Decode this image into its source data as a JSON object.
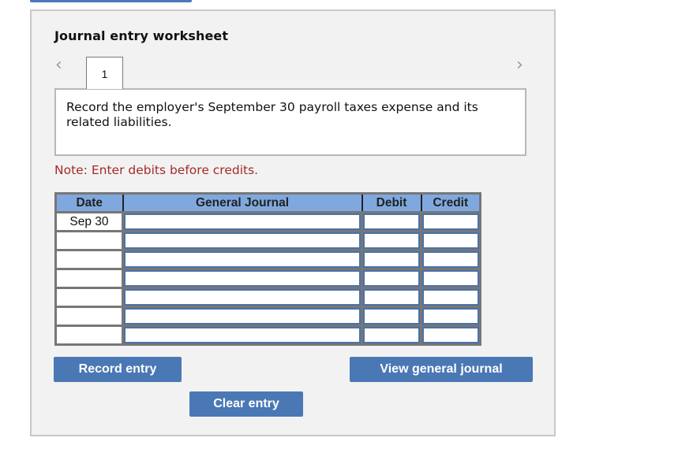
{
  "worksheet": {
    "title": "Journal entry worksheet",
    "nav_prev_icon": "chevron-left-icon",
    "nav_next_icon": "chevron-right-icon",
    "tabs": [
      {
        "label": "1",
        "active": true
      }
    ],
    "prompt": "Record the employer's September 30 payroll taxes expense and its related liabilities.",
    "note": "Note: Enter debits before credits."
  },
  "journal": {
    "headers": [
      "Date",
      "General Journal",
      "Debit",
      "Credit"
    ],
    "rows": [
      {
        "date": "Sep 30",
        "account": "",
        "debit": "",
        "credit": ""
      },
      {
        "date": "",
        "account": "",
        "debit": "",
        "credit": ""
      },
      {
        "date": "",
        "account": "",
        "debit": "",
        "credit": ""
      },
      {
        "date": "",
        "account": "",
        "debit": "",
        "credit": ""
      },
      {
        "date": "",
        "account": "",
        "debit": "",
        "credit": ""
      },
      {
        "date": "",
        "account": "",
        "debit": "",
        "credit": ""
      },
      {
        "date": "",
        "account": "",
        "debit": "",
        "credit": ""
      }
    ]
  },
  "buttons": {
    "record": "Record entry",
    "clear": "Clear entry",
    "view": "View general journal"
  },
  "colors": {
    "accent": "#4a78b5",
    "header_bg": "#7fa9de",
    "note": "#a52a2a",
    "panel_bg": "#f2f2f2"
  }
}
